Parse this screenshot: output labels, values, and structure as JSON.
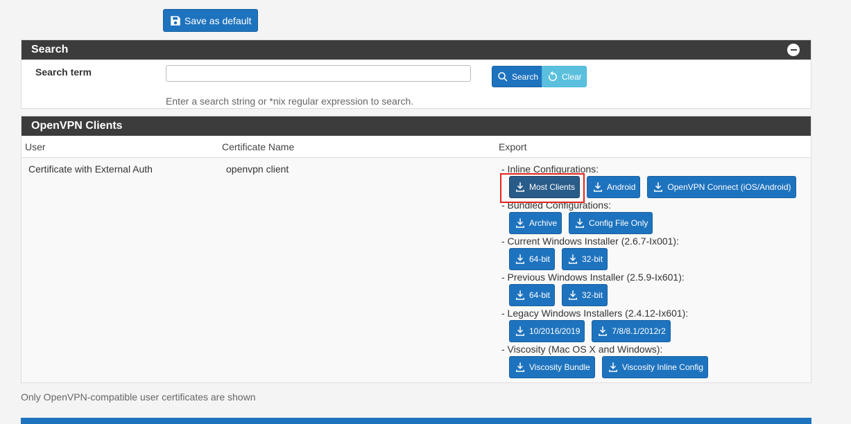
{
  "toolbar": {
    "save_default_label": "Save as default"
  },
  "search": {
    "title": "Search",
    "term_label": "Search term",
    "input_value": "",
    "search_label": "Search",
    "clear_label": "Clear",
    "help_text": "Enter a search string or *nix regular expression to search."
  },
  "clients": {
    "title": "OpenVPN Clients",
    "columns": [
      "User",
      "Certificate Name",
      "Export"
    ],
    "row": {
      "user": "Certificate with External Auth",
      "certificate": "openvpn client"
    },
    "export": {
      "inline_label": "- Inline Configurations:",
      "inline_buttons": [
        "Most Clients",
        "Android",
        "OpenVPN Connect (iOS/Android)"
      ],
      "bundled_label": "- Bundled Configurations:",
      "bundled_buttons": [
        "Archive",
        "Config File Only"
      ],
      "current_win_label": "- Current Windows Installer (2.6.7-Ix001):",
      "current_win_buttons": [
        "64-bit",
        "32-bit"
      ],
      "previous_win_label": "- Previous Windows Installer (2.5.9-Ix601):",
      "previous_win_buttons": [
        "64-bit",
        "32-bit"
      ],
      "legacy_win_label": "- Legacy Windows Installers (2.4.12-Ix601):",
      "legacy_win_buttons": [
        "10/2016/2019",
        "7/8/8.1/2012r2"
      ],
      "viscosity_label": "- Viscosity (Mac OS X and Windows):",
      "viscosity_buttons": [
        "Viscosity Bundle",
        "Viscosity Inline Config"
      ]
    }
  },
  "footnote": "Only OpenVPN-compatible user certificates are shown",
  "colors": {
    "accent": "#1e73be",
    "panel_header": "#3c3c3c",
    "highlight": "#e5231b",
    "clear": "#5bc0de"
  }
}
